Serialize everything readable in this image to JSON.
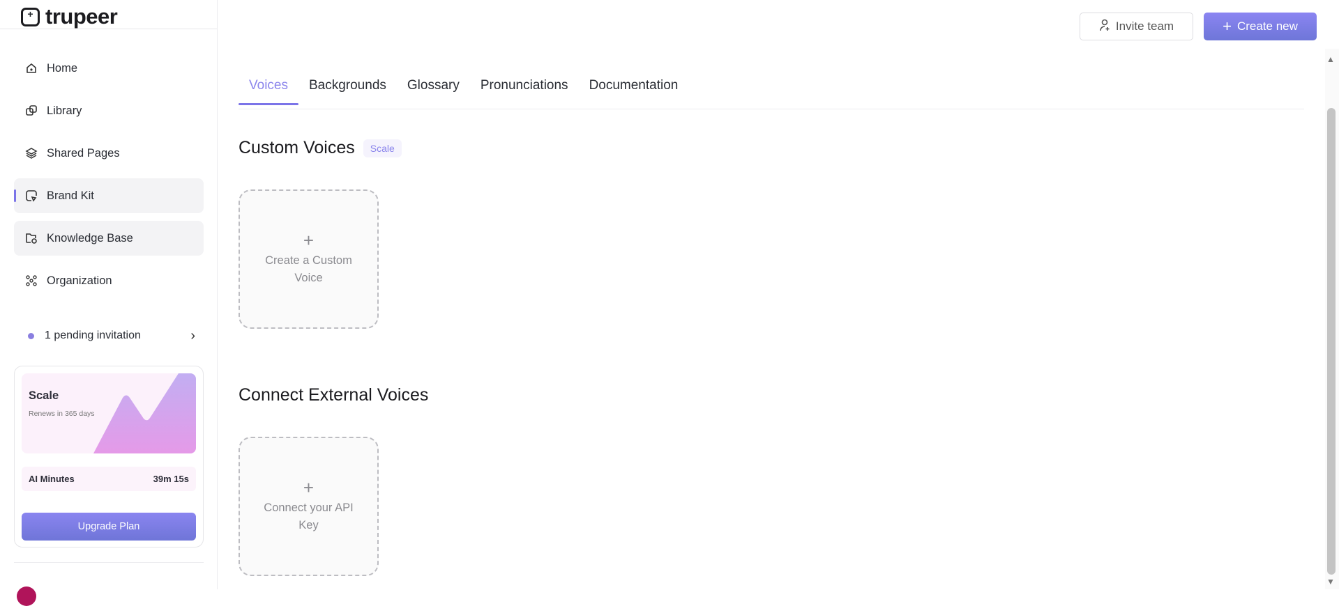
{
  "app": {
    "logo": "trupeer"
  },
  "sidebar": {
    "items": [
      {
        "label": "Home",
        "icon": "home-icon"
      },
      {
        "label": "Library",
        "icon": "library-icon"
      },
      {
        "label": "Shared Pages",
        "icon": "layers-icon"
      },
      {
        "label": "Brand Kit",
        "icon": "brand-kit-icon"
      },
      {
        "label": "Knowledge Base",
        "icon": "folder-icon"
      },
      {
        "label": "Organization",
        "icon": "organization-icon"
      }
    ],
    "active": "Brand Kit",
    "pending": "1 pending invitation",
    "plan": {
      "name": "Scale",
      "renews": "Renews in 365 days",
      "ai_label": "AI Minutes",
      "ai_value": "39m 15s",
      "upgrade": "Upgrade Plan"
    }
  },
  "header": {
    "invite": "Invite team",
    "create": "Create new"
  },
  "tabs": [
    "Voices",
    "Backgrounds",
    "Glossary",
    "Pronunciations",
    "Documentation"
  ],
  "main": {
    "custom_title": "Custom Voices",
    "custom_badge": "Scale",
    "custom_card": "Create a Custom Voice",
    "external_title": "Connect External Voices",
    "external_card": "Connect your API Key"
  },
  "colors": {
    "accent": "#7b74e8"
  }
}
